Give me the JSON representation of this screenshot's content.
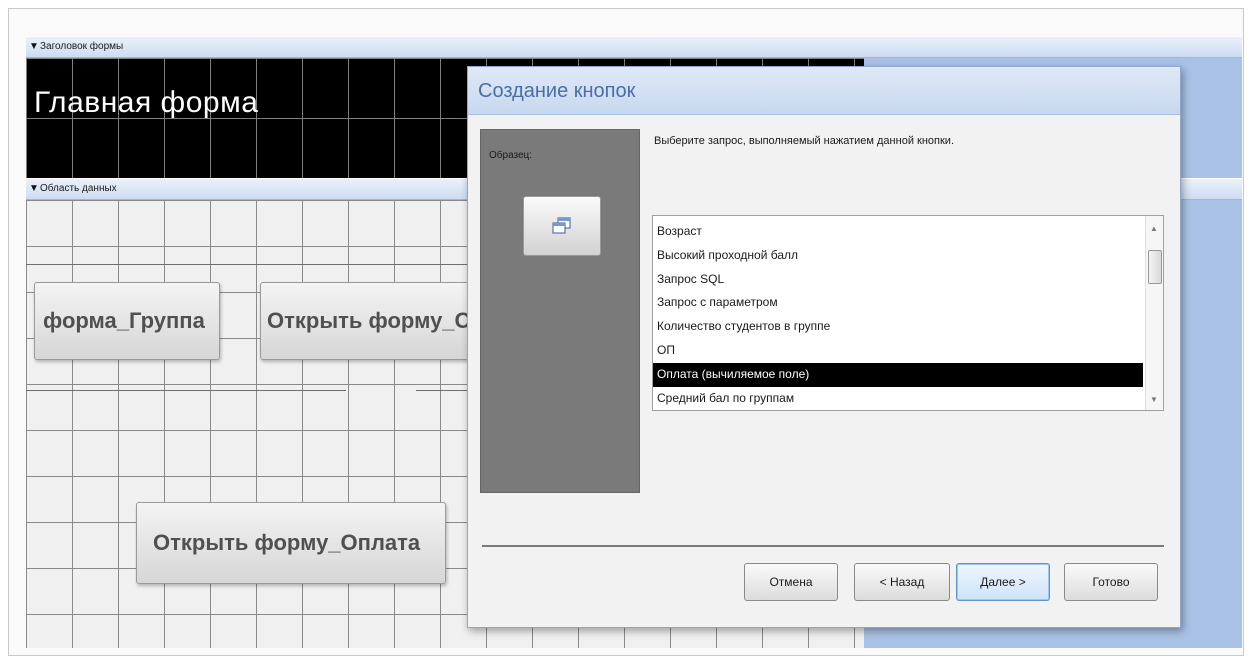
{
  "designer": {
    "header_section_label": "Заголовок формы",
    "data_section_label": "Область данных",
    "form_title": "Главная форма",
    "buttons": [
      {
        "label": "форма_Группа"
      },
      {
        "label": "Открыть форму_С"
      },
      {
        "label": "Открыть форму_Оплата"
      }
    ]
  },
  "dialog": {
    "title": "Создание кнопок",
    "sample_label": "Образец:",
    "instruction": "Выберите запрос, выполняемый нажатием данной кнопки.",
    "queries": [
      "Возраст",
      "Высокий проходной балл",
      "Запрос SQL",
      "Запрос с параметром",
      "Количество студентов в группе",
      "ОП",
      "Оплата (вычиляемое поле)",
      "Средний бал по группам"
    ],
    "selected_query": "Оплата (вычиляемое поле)",
    "buttons": {
      "cancel": "Отмена",
      "back": "< Назад",
      "next": "Далее >",
      "finish": "Готово"
    }
  },
  "colors": {
    "designer_background": "#a9c2e6",
    "header_area": "#000000",
    "selection": "#000000",
    "dialog_title_text": "#4a6fa5"
  }
}
